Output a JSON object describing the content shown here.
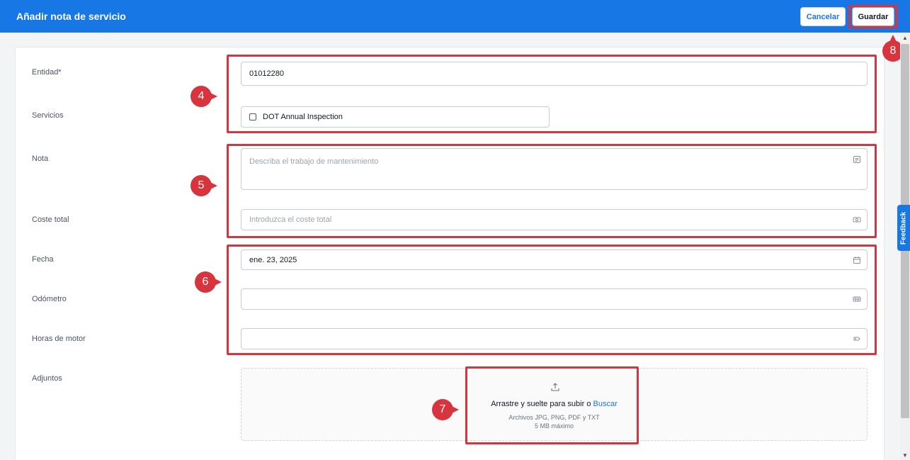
{
  "header": {
    "title": "Añadir nota de servicio",
    "cancel_label": "Cancelar",
    "save_label": "Guardar"
  },
  "form": {
    "entity": {
      "label": "Entidad*",
      "value": "01012280"
    },
    "services": {
      "label": "Servicios",
      "option_label": "DOT Annual Inspection",
      "checked": false
    },
    "note": {
      "label": "Nota",
      "placeholder": "Describa el trabajo de mantenimiento"
    },
    "total_cost": {
      "label": "Coste total",
      "placeholder": "Introduzca el coste total"
    },
    "date": {
      "label": "Fecha",
      "value": "ene. 23, 2025"
    },
    "odometer": {
      "label": "Odómetro",
      "value": ""
    },
    "engine_hours": {
      "label": "Horas de motor",
      "value": ""
    },
    "attachments": {
      "label": "Adjuntos",
      "drop_text": "Arrastre y suelte para subir o ",
      "browse_link": "Buscar",
      "file_types": "Archivos JPG, PNG, PDF y TXT",
      "max_size": "5 MB máximo"
    }
  },
  "feedback_label": "Feedback",
  "callouts": [
    "4",
    "5",
    "6",
    "7",
    "8"
  ],
  "icons": {
    "note": "note-icon",
    "cost": "money-icon",
    "date": "calendar-icon",
    "odometer": "odometer-icon",
    "engine_hours": "engine-icon",
    "upload": "upload-icon"
  },
  "colors": {
    "header_bg": "#1677e5",
    "accent": "#1677e5",
    "callout_red": "#d8343d"
  }
}
